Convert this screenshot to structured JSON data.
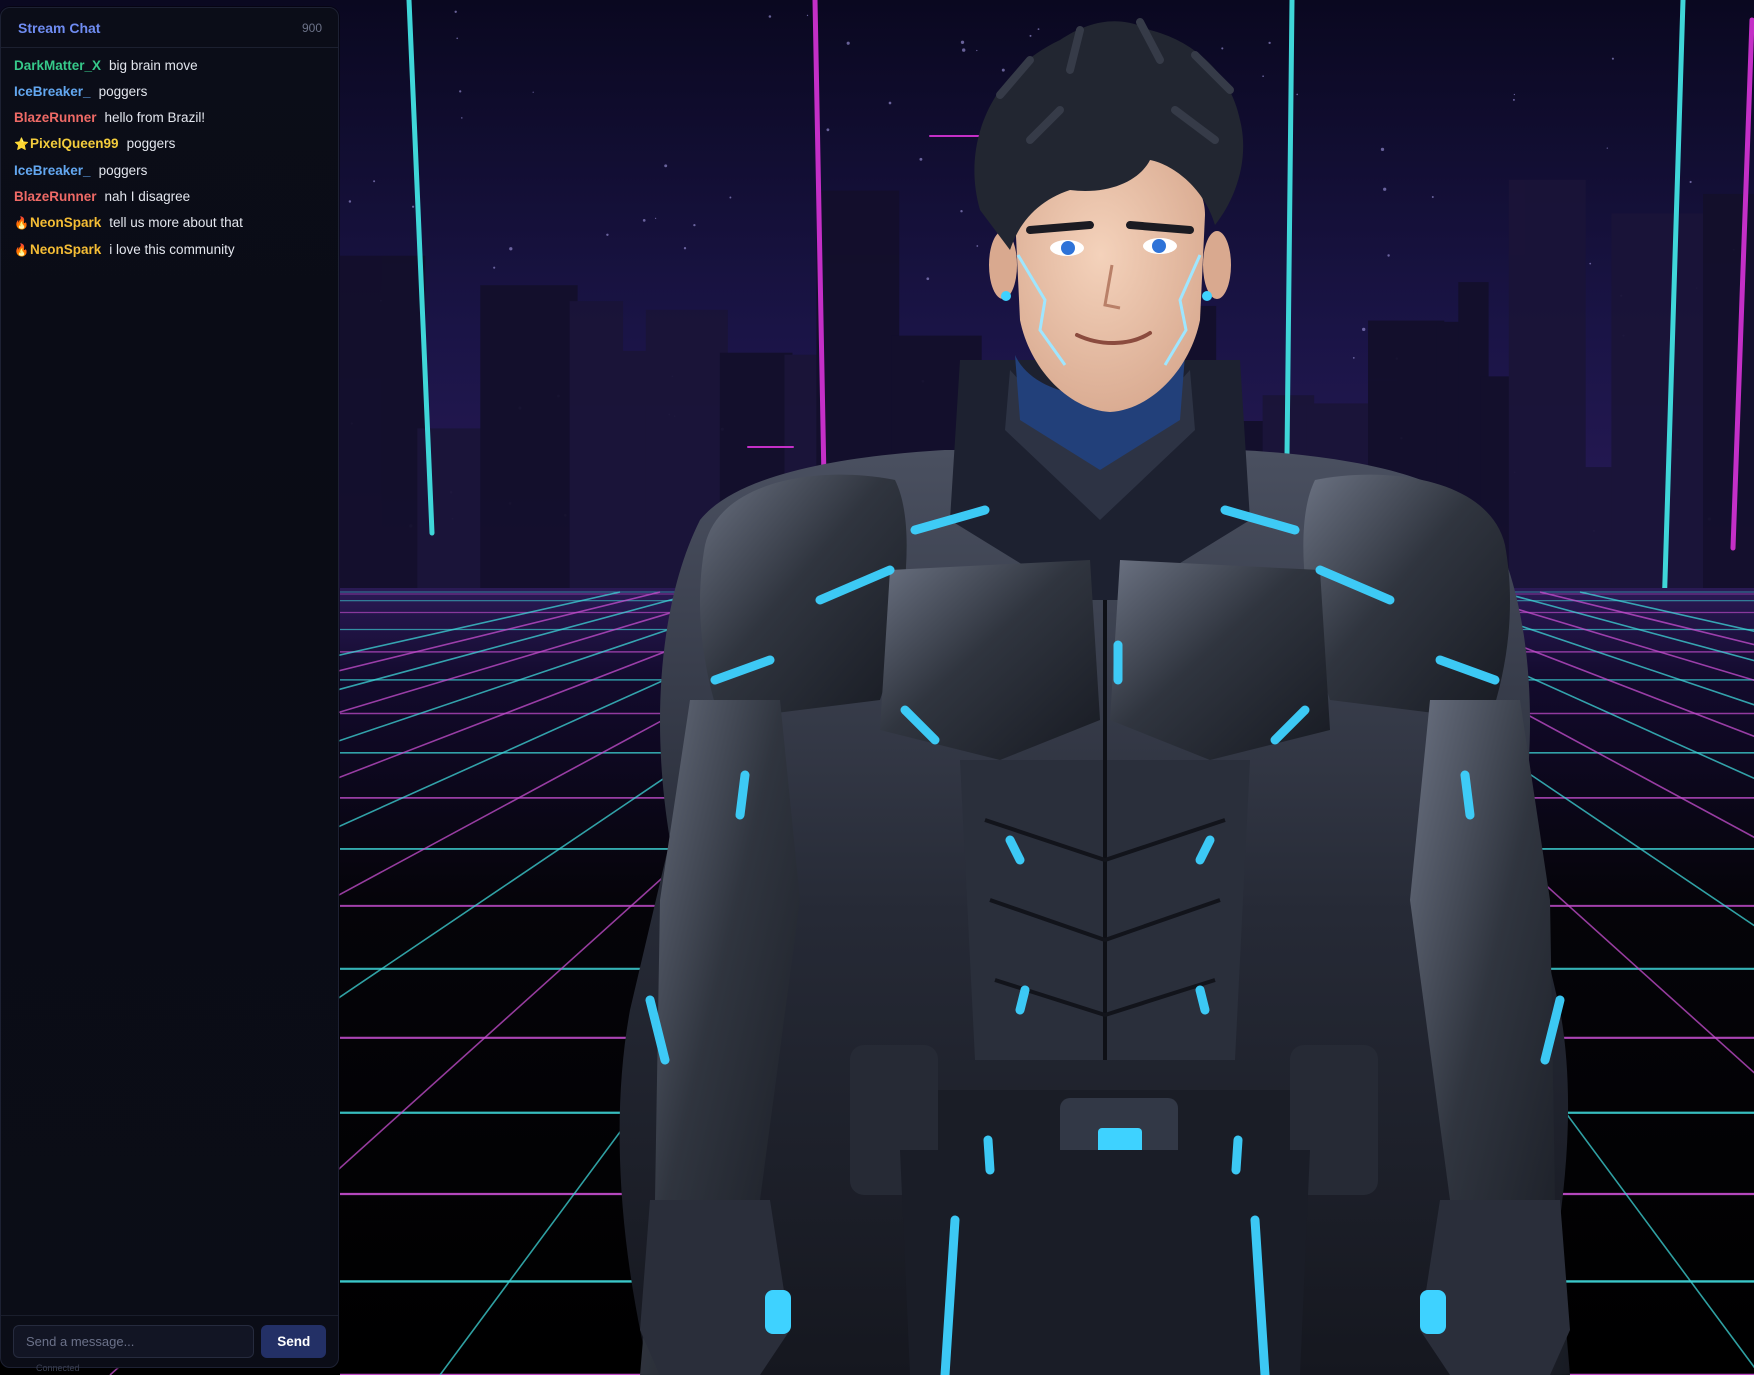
{
  "chat": {
    "title": "Stream Chat",
    "viewer_count": "900",
    "messages": [
      {
        "badge": "",
        "user": "DarkMatter_X",
        "user_color": "#36c98a",
        "text": "big brain move"
      },
      {
        "badge": "",
        "user": "IceBreaker_",
        "user_color": "#63a7f0",
        "text": "poggers"
      },
      {
        "badge": "",
        "user": "BlazeRunner",
        "user_color": "#ef6a66",
        "text": "hello from Brazil!"
      },
      {
        "badge": "⭐",
        "user": "PixelQueen99",
        "user_color": "#f3cc3c",
        "text": "poggers"
      },
      {
        "badge": "",
        "user": "IceBreaker_",
        "user_color": "#63a7f0",
        "text": "poggers"
      },
      {
        "badge": "",
        "user": "BlazeRunner",
        "user_color": "#ef6a66",
        "text": "nah I disagree"
      },
      {
        "badge": "🔥",
        "user": "NeonSpark",
        "user_color": "#f5bd35",
        "text": "tell us more about that"
      },
      {
        "badge": "🔥",
        "user": "NeonSpark",
        "user_color": "#f5bd35",
        "text": "i love this community"
      }
    ],
    "input_placeholder": "Send a message...",
    "send_label": "Send",
    "connection_status": "Connected"
  },
  "colors": {
    "accent": "#6f8cf2",
    "send_button": "#233066",
    "grid_cyan": "#3fd6d8",
    "grid_magenta": "#c74fd0",
    "suit_glow": "#3ed2ff"
  }
}
